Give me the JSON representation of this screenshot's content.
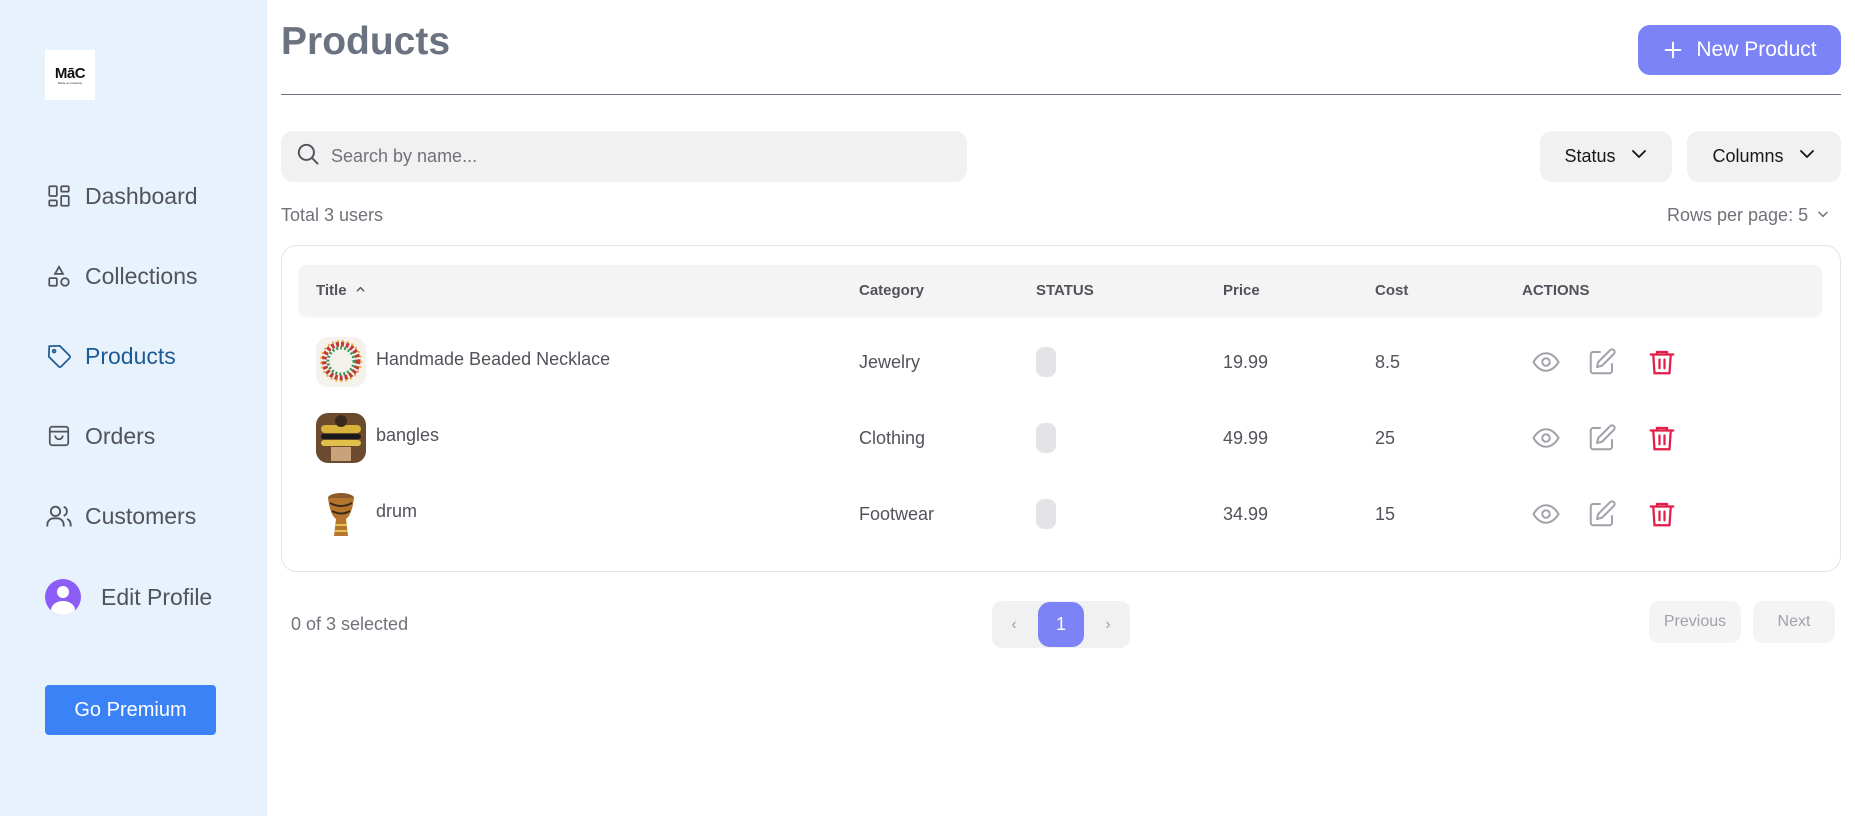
{
  "logo": {
    "text": "MāC",
    "subtext": "Made at Creativity"
  },
  "sidebar": {
    "items": [
      {
        "label": "Dashboard",
        "icon": "dashboard-icon"
      },
      {
        "label": "Collections",
        "icon": "shapes-icon"
      },
      {
        "label": "Products",
        "icon": "tag-icon",
        "active": true
      },
      {
        "label": "Orders",
        "icon": "shopping-bag-icon"
      },
      {
        "label": "Customers",
        "icon": "users-icon"
      }
    ],
    "profile_label": "Edit Profile",
    "premium_label": "Go Premium"
  },
  "header": {
    "title": "Products",
    "new_button_label": "New Product"
  },
  "toolbar": {
    "search_placeholder": "Search by name...",
    "status_label": "Status",
    "columns_label": "Columns",
    "total_text": "Total 3 users",
    "rows_per_page_label": "Rows per page:",
    "rows_per_page_value": "5"
  },
  "table": {
    "columns": [
      "Title",
      "Category",
      "STATUS",
      "Price",
      "Cost",
      "ACTIONS"
    ],
    "rows": [
      {
        "title": "Handmade Beaded Necklace",
        "category": "Jewelry",
        "price": "19.99",
        "cost": "8.5"
      },
      {
        "title": "bangles",
        "category": "Clothing",
        "price": "49.99",
        "cost": "25"
      },
      {
        "title": "drum",
        "category": "Footwear",
        "price": "34.99",
        "cost": "15"
      }
    ]
  },
  "footer": {
    "selected_text": "0 of 3 selected",
    "current_page": "1",
    "previous_label": "Previous",
    "next_label": "Next"
  },
  "colors": {
    "accent": "#7c83f7",
    "premium": "#3b82f6",
    "sidebar_bg": "#e8f2fc",
    "active_nav": "#1e5a94",
    "delete": "#e11d48"
  }
}
